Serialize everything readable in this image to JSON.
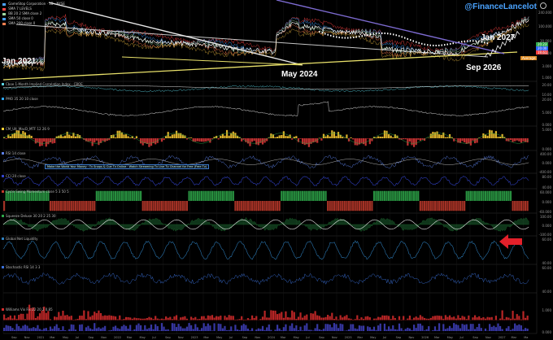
{
  "header": {
    "symbol_line": "GameStop Corporation · 1D · NYSE",
    "indicator_lines": [
      {
        "text": "SMA 7 LEVELS",
        "color": "#ff4444"
      },
      {
        "text": "BB 20 2 SMA close 2",
        "color": "#9fd9a0"
      },
      {
        "text": "SMA 50 close 0",
        "color": "#44a0ff"
      },
      {
        "text": "SMA 200 close 0",
        "color": "#ff7f50"
      }
    ]
  },
  "handle": "@FinanceLancelot",
  "annotations": {
    "jan2021": "Jan 2021",
    "may2024": "May 2024",
    "sep2026": "Sep 2026",
    "jan2027": "Jan 2027"
  },
  "price_labels": [
    {
      "text": "20.23",
      "color": "#2ea84a"
    },
    {
      "text": "20.00",
      "color": "#2962ff"
    },
    {
      "text": "19.61",
      "color": "#ff4040"
    },
    {
      "text": "Average",
      "color": "#e0902a"
    }
  ],
  "main_scale": [
    "240.000",
    "100.000",
    "30.000",
    "10.000",
    "3.000",
    "1.000"
  ],
  "panes": [
    {
      "id": "vix",
      "label": "Cboe 1-Month Implied Correlation Index · CBOE",
      "color": "#5ad1e0",
      "scale": [
        "20.00",
        "10.00"
      ],
      "color2": "#ffffff"
    },
    {
      "id": "pmo",
      "label": "PMO 35 20 10 close",
      "color": "#2ea8ff",
      "scale": [
        "20.00",
        "5.000",
        "0.000"
      ],
      "color2": "#c0c0c0"
    },
    {
      "id": "ssl",
      "label": "CM_Ult_MacD_MTF 12 26 9",
      "color": "#ffcf33",
      "scale": [
        "5.000",
        "0.000"
      ],
      "color2": "#e23a3a"
    },
    {
      "id": "rsi14",
      "label": "RSI 14 close",
      "color": "#5b7fe6",
      "scale": [
        "400.00",
        "0.000",
        "-400.00"
      ],
      "color2": "#ffffff"
    },
    {
      "id": "cci",
      "label": "CCI 20 close",
      "color": "#3344cc",
      "scale": [
        "80.00",
        "40.00"
      ],
      "color2": "#ffffff"
    },
    {
      "id": "cycle",
      "label": "Cycle Swing Momentum close 5 3 50 5",
      "color": "#c0392b",
      "scale": [
        "60.000",
        "0.000",
        "-60.000"
      ],
      "color2": "#2ea84a"
    },
    {
      "id": "squeeze",
      "label": "Squeeze Deluxe 30 20 2 25 30",
      "color": "#2ea84a",
      "scale": [
        "100.00",
        "0.000",
        "-100.00"
      ],
      "color2": "#ffffff"
    },
    {
      "id": "netliq",
      "label": "Global Net Liquidity",
      "color": "#2e7fbf",
      "scale": [
        "60.00",
        "40.00"
      ],
      "color2": "#ffffff"
    },
    {
      "id": "mfi",
      "label": "Stochastic RSI 14 3 3",
      "color": "#3a6fd6",
      "scale": [
        "60.00",
        "40.00"
      ],
      "color2": "#a03c9a"
    },
    {
      "id": "vol",
      "label": "Williams Vix Fix 22 20 2 0.85",
      "color": "#d62c2c",
      "scale": [
        "1.000",
        "0.000"
      ],
      "color2": "#4f4fe8"
    }
  ],
  "tooltip": "Make the World Your Money · Tv Snaps & Cue Tv Online · Watch Streaming Tv Live Tv Channel for Free (Free Tv)",
  "x_axis": [
    "Sep",
    "Nov",
    "2021",
    "Mar",
    "May",
    "Jul",
    "Sep",
    "Nov",
    "2022",
    "Mar",
    "May",
    "Jul",
    "Sep",
    "Nov",
    "2023",
    "Mar",
    "May",
    "Jul",
    "Sep",
    "Nov",
    "2024",
    "Mar",
    "May",
    "Jul",
    "Sep",
    "Nov",
    "2025",
    "Mar",
    "May",
    "Jul",
    "Sep",
    "Nov",
    "2026",
    "Mar",
    "May",
    "Jul",
    "Sep",
    "Nov",
    "2027",
    "Mar",
    "Ma"
  ],
  "colors": {
    "background": "#000000",
    "trendline_white": "#e8e8e8",
    "trendline_yellow": "#e8e06a",
    "trendline_purple": "#7d6bd1",
    "arrow": "#e3202a"
  }
}
